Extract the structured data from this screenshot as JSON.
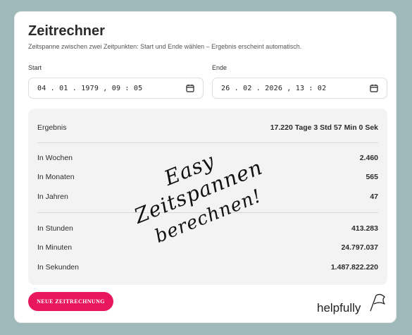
{
  "card": {
    "title": "Zeitrechner",
    "subtitle": "Zeitspanne zwischen zwei Zeitpunkten: Start und Ende wählen – Ergebnis erscheint automatisch."
  },
  "start": {
    "label": "Start",
    "value": "04.01.1979, 09:05",
    "display": "04 . 01 . 1979 ,  09 : 05"
  },
  "end": {
    "label": "Ende",
    "value": "26.02.2026, 13:02",
    "display": "26 . 02 . 2026 ,  13 : 02"
  },
  "results": {
    "summary": {
      "label": "Ergebnis",
      "value": "17.220 Tage 3 Std 57 Min 0 Sek"
    },
    "group1": [
      {
        "label": "In Wochen",
        "value": "2.460"
      },
      {
        "label": "In Monaten",
        "value": "565"
      },
      {
        "label": "In Jahren",
        "value": "47"
      }
    ],
    "group2": [
      {
        "label": "In Stunden",
        "value": "413.283"
      },
      {
        "label": "In Minuten",
        "value": "24.797.037"
      },
      {
        "label": "In Sekunden",
        "value": "1.487.822.220"
      }
    ]
  },
  "button": {
    "label": "NEUE ZEITRECHNUNG"
  },
  "overlay": {
    "line1": "Easy Zeitspannen",
    "line2": "berechnen!"
  },
  "logo": {
    "text": "helpfully"
  },
  "colors": {
    "accent": "#e8175d",
    "background": "#9fb9ba",
    "panel": "#f3f3f3"
  }
}
